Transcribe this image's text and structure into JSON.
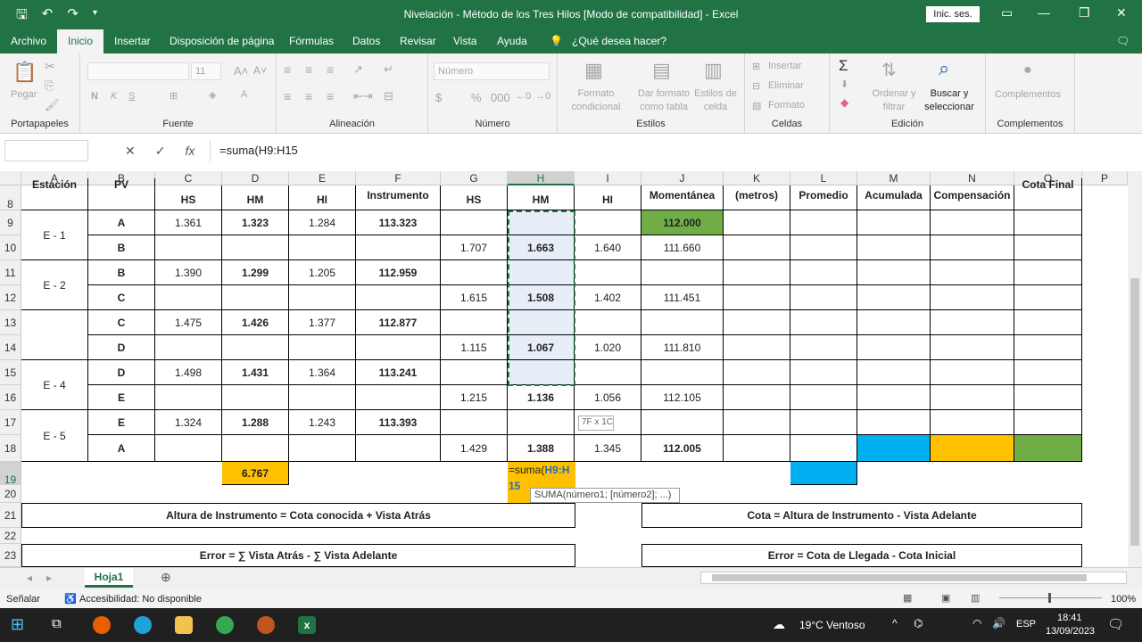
{
  "window": {
    "title": "Nivelación - Método de los Tres Hilos  [Modo de compatibilidad]  -  Excel",
    "signin": "Inic. ses."
  },
  "menu": {
    "items": [
      "Archivo",
      "Inicio",
      "Insertar",
      "Disposición de página",
      "Fórmulas",
      "Datos",
      "Revisar",
      "Vista",
      "Ayuda"
    ],
    "tell": "¿Qué desea hacer?"
  },
  "ribbon": {
    "paste": "Pegar",
    "portapapeles": "Portapapeles",
    "fuente": "Fuente",
    "font_size": "11",
    "alineacion": "Alineación",
    "numero_format": "Número",
    "numero": "Número",
    "format_cond": "Formato condicional",
    "format_table": "Dar formato como tabla",
    "cell_styles": "Estilos de celda",
    "estilos": "Estilos",
    "insertar": "Insertar",
    "eliminar": "Eliminar",
    "formato": "Formato",
    "celdas": "Celdas",
    "ordenar": "Ordenar y filtrar",
    "buscar": "Buscar y seleccionar",
    "edicion": "Edición",
    "complementos_btn": "Complementos",
    "complementos": "Complementos"
  },
  "formula": {
    "value": "=suma(H9:H15"
  },
  "columns": [
    "A",
    "B",
    "C",
    "D",
    "E",
    "F",
    "G",
    "H",
    "I",
    "J",
    "K",
    "L",
    "M",
    "N",
    "O",
    "P"
  ],
  "row_numbers": [
    "8",
    "9",
    "10",
    "11",
    "12",
    "13",
    "14",
    "15",
    "16",
    "17",
    "18",
    "19",
    "20",
    "21",
    "22",
    "23"
  ],
  "header_row": {
    "A": "Estación",
    "B": "PV",
    "C": "HS",
    "D": "HM",
    "E": "HI",
    "F": "Instrumento",
    "G": "HS",
    "H": "HM",
    "I": "HI",
    "J": "Momentánea",
    "K": "(metros)",
    "L": "Promedio",
    "M": "Acumulada",
    "N": "Compensación",
    "O": "Cota Final"
  },
  "stations": [
    "E - 1",
    "E - 2",
    "",
    "E - 4",
    "E - 5"
  ],
  "rows": [
    {
      "B": "A",
      "C": "1.361",
      "D": "1.323",
      "E": "1.284",
      "F": "113.323",
      "G": "",
      "H": "",
      "I": "",
      "J": "112.000"
    },
    {
      "B": "B",
      "C": "",
      "D": "",
      "E": "",
      "F": "",
      "G": "1.707",
      "H": "1.663",
      "I": "1.640",
      "J": "111.660"
    },
    {
      "B": "B",
      "C": "1.390",
      "D": "1.299",
      "E": "1.205",
      "F": "112.959",
      "G": "",
      "H": "",
      "I": "",
      "J": ""
    },
    {
      "B": "C",
      "C": "",
      "D": "",
      "E": "",
      "F": "",
      "G": "1.615",
      "H": "1.508",
      "I": "1.402",
      "J": "111.451"
    },
    {
      "B": "C",
      "C": "1.475",
      "D": "1.426",
      "E": "1.377",
      "F": "112.877",
      "G": "",
      "H": "",
      "I": "",
      "J": ""
    },
    {
      "B": "D",
      "C": "",
      "D": "",
      "E": "",
      "F": "",
      "G": "1.115",
      "H": "1.067",
      "I": "1.020",
      "J": "111.810"
    },
    {
      "B": "D",
      "C": "1.498",
      "D": "1.431",
      "E": "1.364",
      "F": "113.241",
      "G": "",
      "H": "",
      "I": "",
      "J": ""
    },
    {
      "B": "E",
      "C": "",
      "D": "",
      "E": "",
      "F": "",
      "G": "1.215",
      "H": "1.136",
      "I": "1.056",
      "J": "112.105"
    },
    {
      "B": "E",
      "C": "1.324",
      "D": "1.288",
      "E": "1.243",
      "F": "113.393",
      "G": "",
      "H": "",
      "I": "",
      "J": ""
    },
    {
      "B": "A",
      "C": "",
      "D": "",
      "E": "",
      "F": "",
      "G": "1.429",
      "H": "1.388",
      "I": "1.345",
      "J": "112.005"
    }
  ],
  "sum_d": "6.767",
  "edit_cell": {
    "text_a": "=suma(",
    "text_b": "H9:",
    "text_c": "H15"
  },
  "tooltip": "SUMA(número1; [número2]; ...)",
  "range_hint": "7F x 1C",
  "notes": {
    "r21_left": "Altura de Instrumento = Cota conocida + Vista Atrás",
    "r21_right": "Cota = Altura de Instrumento - Vista Adelante",
    "r23_left": "Error = ∑ Vista Atrás - ∑ Vista Adelante",
    "r23_right": "Error = Cota de Llegada - Cota Inicial"
  },
  "sheet_tab": "Hoja1",
  "status": {
    "mode": "Señalar",
    "access": "Accesibilidad: No disponible",
    "zoom": "100%"
  },
  "taskbar": {
    "weather": "19°C  Ventoso",
    "lang": "ESP",
    "time": "18:41",
    "date": "13/09/2023"
  },
  "colors": {
    "excel_green": "#217346",
    "green_cell": "#70ad47",
    "orange": "#ffc000",
    "blue": "#00b0f0",
    "green_fill": "#92d050"
  }
}
